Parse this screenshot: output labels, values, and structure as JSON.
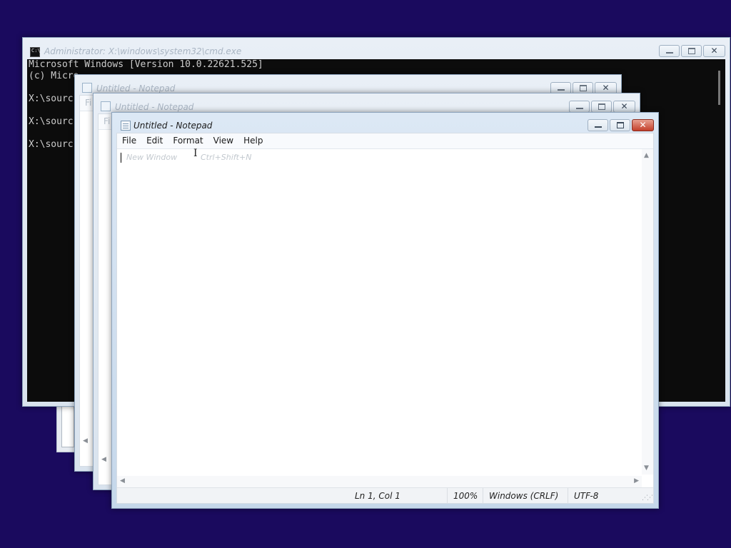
{
  "cmd": {
    "title": "Administrator: X:\\windows\\system32\\cmd.exe",
    "icon": "console-icon",
    "lines": [
      "Microsoft Windows [Version 10.0.22621.525]",
      "(c) Micro",
      "",
      "X:\\sourc",
      "",
      "X:\\sourc",
      "",
      "X:\\sourc"
    ]
  },
  "notepad_back": {
    "title": "Untitled - Notepad",
    "menu_first": "Fi",
    "icon": "notepad-icon"
  },
  "notepad_middle": {
    "title": "Untitled - Notepad",
    "menu_first": "Fi",
    "icon": "notepad-icon"
  },
  "notepad": {
    "title": "Untitled - Notepad",
    "icon": "notepad-icon",
    "menu": [
      "File",
      "Edit",
      "Format",
      "View",
      "Help"
    ],
    "ghost_item": {
      "label": "New Window",
      "shortcut": "Ctrl+Shift+N"
    },
    "status": {
      "position": "Ln 1, Col 1",
      "zoom": "100%",
      "line_ending": "Windows (CRLF)",
      "encoding": "UTF-8"
    }
  },
  "colors": {
    "desktop": "#1a0a5e",
    "console_bg": "#0c0c0c",
    "console_text": "#cccccc",
    "close_active": "#c33f2a"
  }
}
